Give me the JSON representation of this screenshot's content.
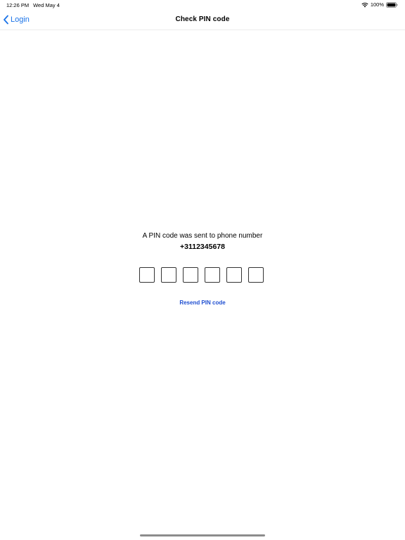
{
  "status_bar": {
    "time": "12:26 PM",
    "date": "Wed May 4",
    "battery": "100%"
  },
  "nav": {
    "back_label": "Login",
    "title": "Check PIN code"
  },
  "content": {
    "message": "A PIN code was sent to phone number",
    "phone_number": "+3112345678",
    "pin_fields": [
      "",
      "",
      "",
      "",
      "",
      ""
    ],
    "resend_label": "Resend PIN code"
  },
  "colors": {
    "accent": "#1a73e8",
    "link": "#1f4fd1"
  }
}
